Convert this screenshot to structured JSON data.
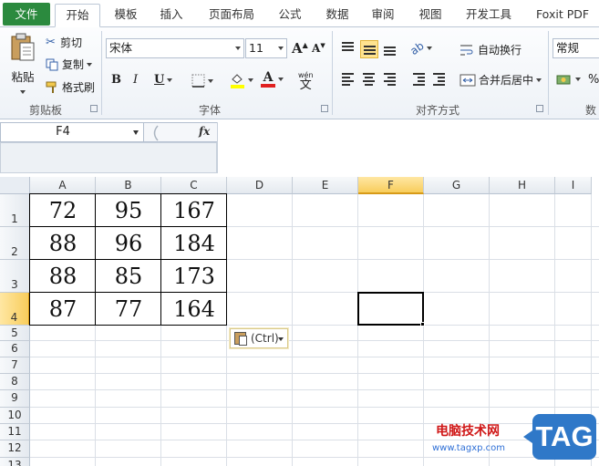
{
  "ribbon_tabs": [
    "文件",
    "开始",
    "模板",
    "插入",
    "页面布局",
    "公式",
    "数据",
    "审阅",
    "视图",
    "开发工具",
    "Foxit PDF"
  ],
  "clipboard": {
    "paste": "粘贴",
    "cut": "剪切",
    "copy": "复制",
    "format_painter": "格式刷",
    "group_label": "剪贴板"
  },
  "font": {
    "name": "宋体",
    "size": "11",
    "grow": "A",
    "shrink": "A",
    "bold": "B",
    "italic": "I",
    "underline": "U",
    "font_color_glyph": "A",
    "phonetic_glyph": "wén",
    "group_label": "字体"
  },
  "alignment": {
    "wrap_text": "自动换行",
    "merge_center": "合并后居中",
    "group_label": "对齐方式"
  },
  "number": {
    "format": "常规",
    "percent": "%",
    "group_label": "数"
  },
  "formula_bar": {
    "name_box": "F4",
    "fx": "fx",
    "formula": ""
  },
  "grid": {
    "columns": [
      "A",
      "B",
      "C",
      "D",
      "E",
      "F",
      "G",
      "H",
      "I"
    ],
    "rows": [
      "1",
      "2",
      "3",
      "4",
      "5",
      "6",
      "7",
      "8",
      "9",
      "10",
      "11",
      "12",
      "13"
    ],
    "selected_column": "F",
    "selected_row": "4",
    "table": [
      [
        "72",
        "95",
        "167"
      ],
      [
        "88",
        "96",
        "184"
      ],
      [
        "88",
        "85",
        "173"
      ],
      [
        "87",
        "77",
        "164"
      ]
    ]
  },
  "paste_options": {
    "label": "(Ctrl)"
  },
  "watermark": {
    "site": "电脑技术网",
    "url": "www.tagxp.com",
    "tag": "TAG"
  },
  "colors": {
    "file_tab": "#2b8a3e",
    "selected_header": "#f8cd5c",
    "watermark_red": "#d01818",
    "watermark_blue": "#2f78c8"
  }
}
